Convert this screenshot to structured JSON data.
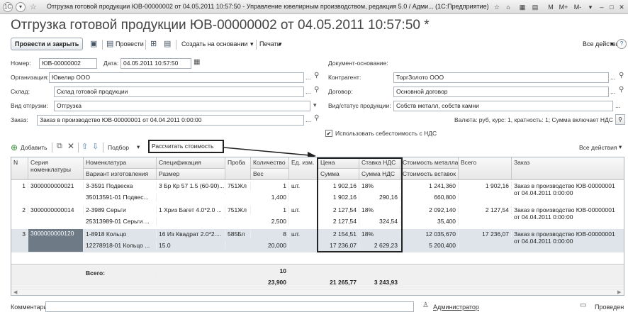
{
  "window": {
    "title": "Отгрузка готовой продукции ЮВ-00000002 от 04.05.2011 10:57:50 - Управление ювелирным производством, редакция 5.0 / Адми... (1С:Предприятие)",
    "m_buttons": [
      "M",
      "M+",
      "M-"
    ]
  },
  "doc_title": "Отгрузка готовой продукции ЮВ-00000002 от 04.05.2011 10:57:50 *",
  "toolbar": {
    "post_close": "Провести и закрыть",
    "post": "Провести",
    "create_based": "Создать на основании",
    "print": "Печать",
    "all_actions": "Все действия"
  },
  "fields": {
    "number_label": "Номер:",
    "number": "ЮВ-00000002",
    "date_label": "Дата:",
    "date": "04.05.2011 10:57:50",
    "base_doc_label": "Документ-основание:",
    "org_label": "Организация:",
    "org": "Ювелир ООО",
    "contractor_label": "Контрагент:",
    "contractor": "ТоргЗолото ООО",
    "warehouse_label": "Склад:",
    "warehouse": "Склад готовой продукции",
    "contract_label": "Договор:",
    "contract": "Основной договор",
    "shipment_type_label": "Вид отгрузки:",
    "shipment_type": "Отгрузка",
    "product_type_label": "Вид/статус продукции:",
    "product_type": "Собств металл, собств камни",
    "order_label": "Заказ:",
    "order": "Заказ в производство ЮВ-00000001 от 04.04.2011 0:00:00",
    "currency_info": "Валюта: руб, курс: 1, кратность: 1; Сумма включает НДС",
    "use_cost_label": "Использовать себестоимость с НДС",
    "use_cost_checked": true
  },
  "table_toolbar": {
    "add": "Добавить",
    "selection": "Подбор",
    "calc_cost": "Рассчитать стоимость",
    "all_actions": "Все действия"
  },
  "columns": {
    "n": "N",
    "series": "Серия номенклатуры",
    "nomenclature": "Номенклатура",
    "variant": "Вариант изготовления",
    "spec": "Спецификация",
    "size": "Размер",
    "proba": "Проба",
    "qty": "Количество",
    "weight": "Вес",
    "unit": "Ед. изм.",
    "price": "Цена",
    "sum": "Сумма",
    "vat_rate": "Ставка НДС",
    "vat_sum": "Сумма НДС",
    "metal_cost": "Стоимость металла",
    "inserts_cost": "Стоимость вставок",
    "total": "Всего",
    "order": "Заказ"
  },
  "rows": [
    {
      "n": "1",
      "series": "3000000000021",
      "nom": "3-3591 Подвеска",
      "variant": "35013591-01 Подвес...",
      "spec": "3 Бр Кр 57 1.5 (60-90)...",
      "size": "",
      "proba": "751Жл",
      "qty": "1",
      "weight": "1,400",
      "unit": "шт.",
      "price": "1 902,16",
      "sum": "1 902,16",
      "vat_rate": "18%",
      "vat_sum": "290,16",
      "metal": "1 241,360",
      "inserts": "660,800",
      "total": "1 902,16",
      "order": "Заказ в производство ЮВ-00000001 от 04.04.2011 0:00:00"
    },
    {
      "n": "2",
      "series": "3000000000014",
      "nom": "2-3989 Серьги",
      "variant": "25313989-01 Серьги ...",
      "spec": "1 Хриз Багет 4.0*2.0 ...",
      "size": "",
      "proba": "751Жл",
      "qty": "1",
      "weight": "2,500",
      "unit": "шт.",
      "price": "2 127,54",
      "sum": "2 127,54",
      "vat_rate": "18%",
      "vat_sum": "324,54",
      "metal": "2 092,140",
      "inserts": "35,400",
      "total": "2 127,54",
      "order": "Заказ в производство ЮВ-00000001 от 04.04.2011 0:00:00"
    },
    {
      "n": "3",
      "series": "3000000000120",
      "nom": "1-8918 Кольцо",
      "variant": "12278918-01 Кольцо ...",
      "spec": "16 Из Квадрат 2.0*2....",
      "size": "15.0",
      "proba": "585Бл",
      "qty": "8",
      "weight": "20,000",
      "unit": "шт.",
      "price": "2 154,51",
      "sum": "17 236,07",
      "vat_rate": "18%",
      "vat_sum": "2 629,23",
      "metal": "12 035,670",
      "inserts": "5 200,400",
      "total": "17 236,07",
      "order": "Заказ в производство ЮВ-00000001 от 04.04.2011 0:00:00"
    }
  ],
  "totals": {
    "label": "Всего:",
    "qty": "10",
    "weight": "23,900",
    "sum": "21 265,77",
    "vat_sum": "3 243,93"
  },
  "footer": {
    "comment_label": "Комментарий:",
    "user": "Администратор",
    "status": "Проведен"
  }
}
